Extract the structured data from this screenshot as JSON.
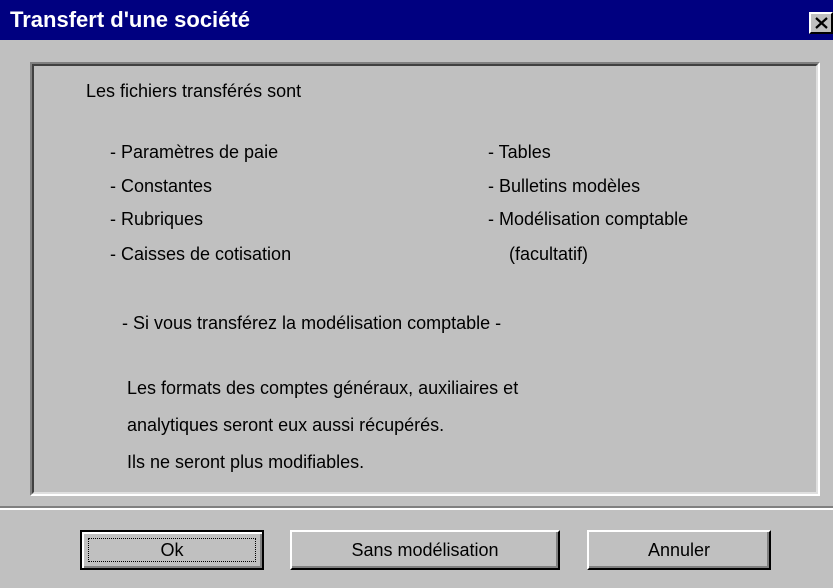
{
  "window": {
    "title": "Transfert d'une société",
    "close_icon": "close-icon"
  },
  "content": {
    "intro": "Les fichiers transférés sont",
    "left_items": [
      "- Paramètres de paie",
      "- Constantes",
      "- Rubriques",
      "- Caisses de cotisation"
    ],
    "right_items": [
      "- Tables",
      "- Bulletins modèles",
      "- Modélisation comptable",
      "(facultatif)"
    ],
    "notice_heading": "- Si vous transférez la modélisation comptable -",
    "notice_lines": [
      "Les formats des comptes généraux, auxiliaires et",
      "analytiques seront eux aussi récupérés.",
      "Ils ne seront plus modifiables."
    ]
  },
  "buttons": {
    "ok": "Ok",
    "sans_modelisation": "Sans modélisation",
    "annuler": "Annuler"
  }
}
